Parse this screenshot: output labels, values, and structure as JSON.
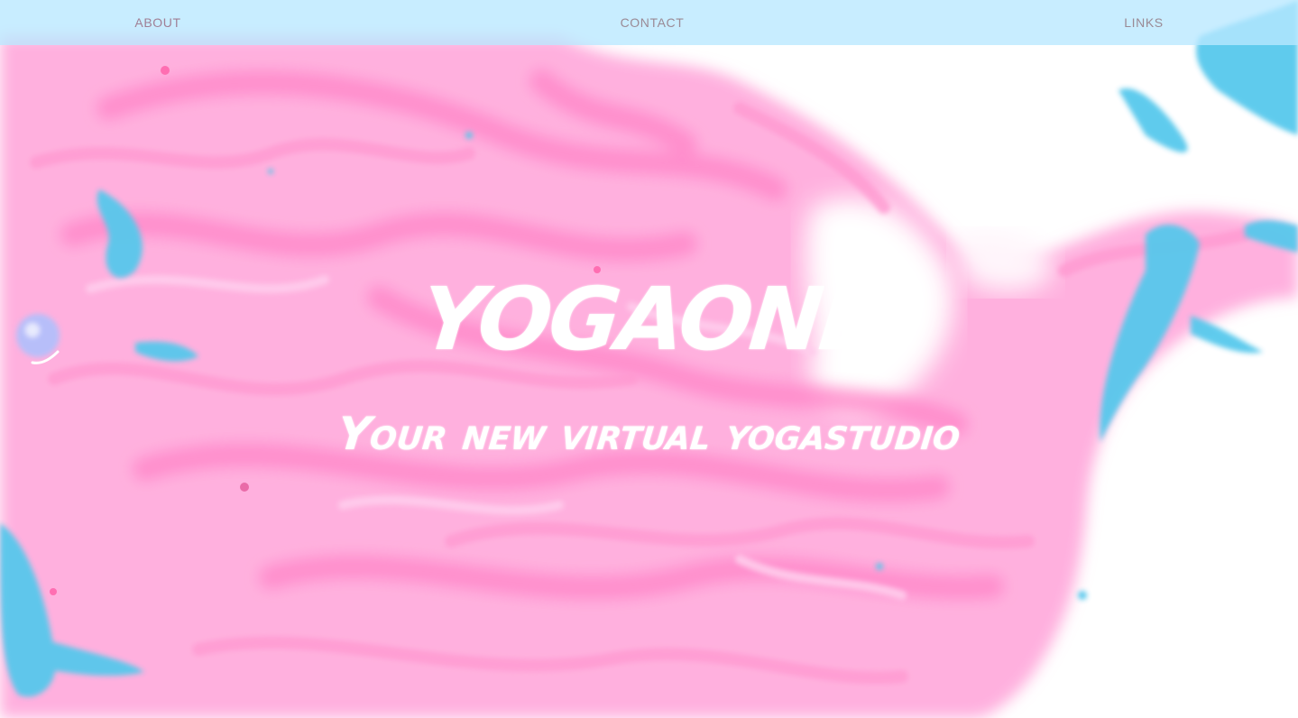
{
  "nav": {
    "items": [
      {
        "label": "ABOUT"
      },
      {
        "label": "CONTACT"
      },
      {
        "label": "LINKS"
      }
    ]
  },
  "hero": {
    "title": "YOGAONE",
    "subtitle": "Your new virtual yogastudio"
  },
  "colors": {
    "nav_bar": "#b8e8ff",
    "marble_pink": "#ff9fd6",
    "marble_deep_pink": "#ff6fbd",
    "marble_blue": "#3fc1ea",
    "marble_white": "#ffffff",
    "hero_text": "#ffffff"
  }
}
